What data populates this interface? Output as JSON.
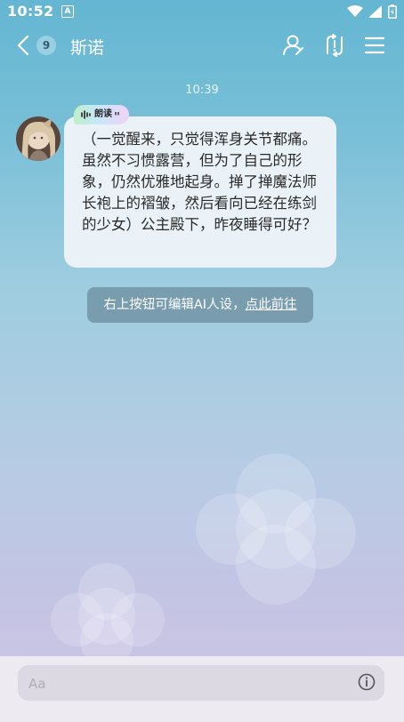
{
  "status_bar": {
    "time": "10:52",
    "notification_icon": "A"
  },
  "header": {
    "back_badge": "9",
    "title": "斯诺"
  },
  "chat": {
    "timestamp": "10:39",
    "read_aloud_label": "朗读",
    "message": "（一觉醒来，只觉得浑身关节都痛。虽然不习惯露营，但为了自己的形象，仍然优雅地起身。掸了掸魔法师长袍上的褶皱，然后看向已经在练剑的少女）公主殿下，昨夜睡得可好？"
  },
  "hint": {
    "text": "右上按钮可编辑AI人设，",
    "link": "点此前往"
  },
  "composer": {
    "placeholder": "Aa"
  },
  "colors": {
    "accent_top": "#64b6d2",
    "accent_bottom": "#cfc6e6",
    "bubble": "#eaf2f7",
    "hint_bg": "#608090"
  }
}
